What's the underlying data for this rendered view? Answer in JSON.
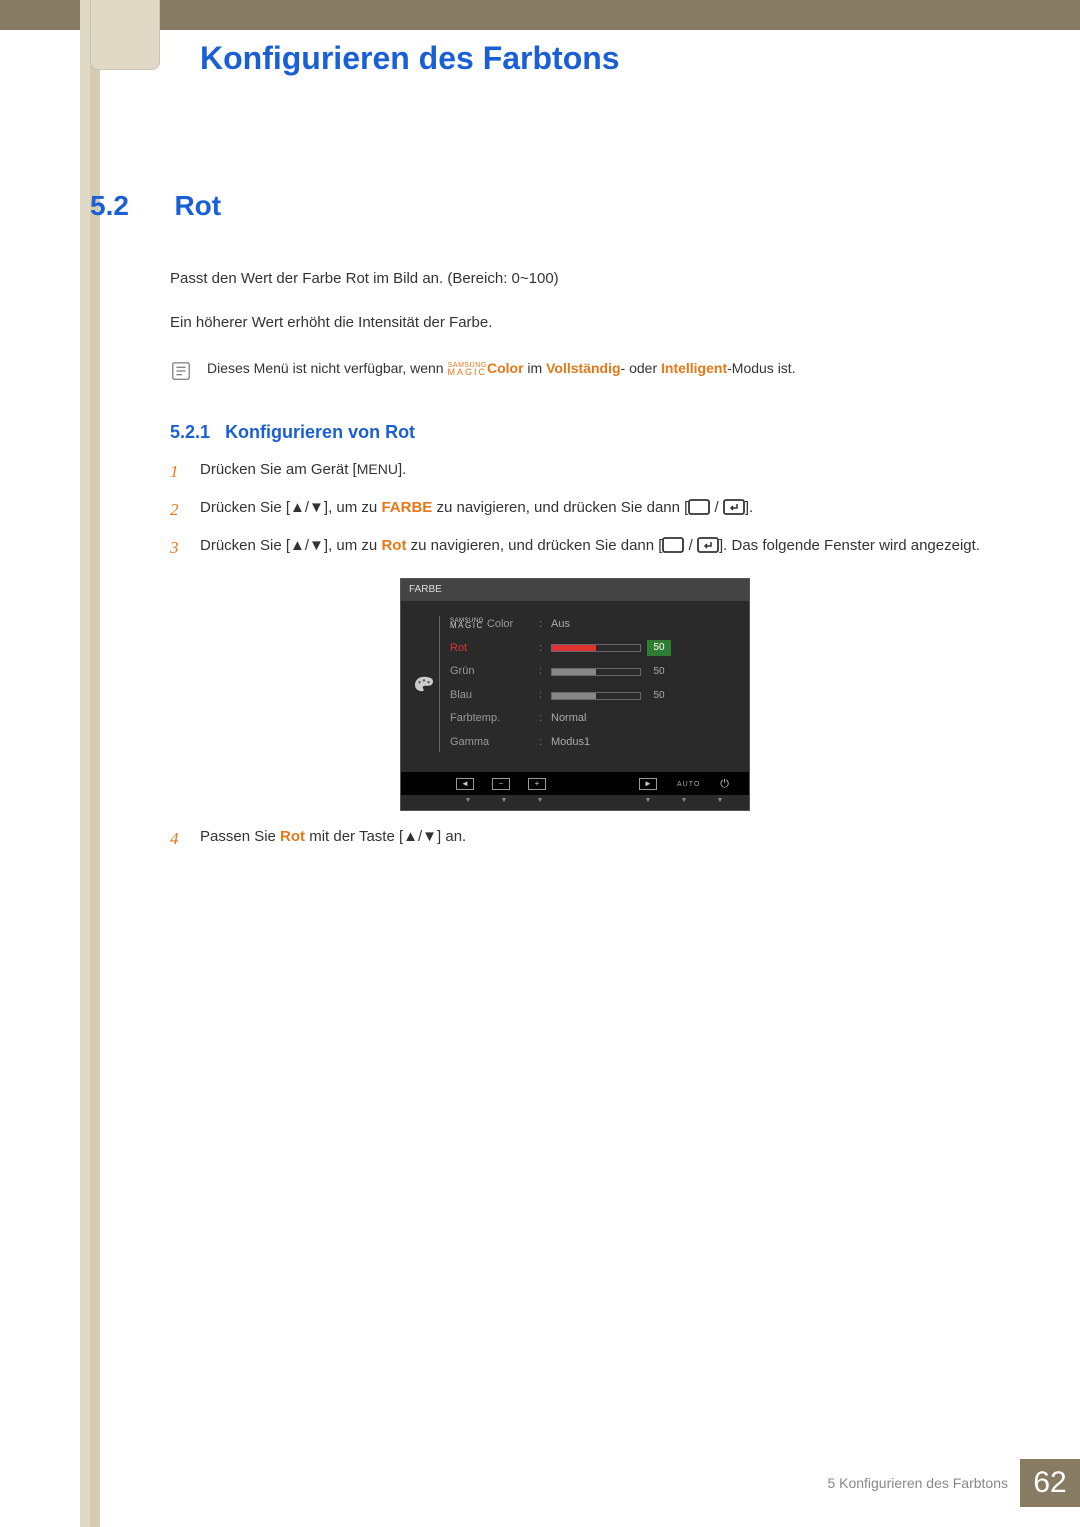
{
  "header": {
    "title": "Konfigurieren des Farbtons"
  },
  "section": {
    "number": "5.2",
    "title": "Rot",
    "paragraphs": {
      "p1": "Passt den Wert der Farbe Rot im Bild an. (Bereich: 0~100)",
      "p2": "Ein höherer Wert erhöht die Intensität der Farbe."
    },
    "note": {
      "pre": "Dieses Menü ist nicht verfügbar, wenn ",
      "magic_top": "SAMSUNG",
      "magic_bot": "MAGIC",
      "color_word": "Color",
      "mid": " im ",
      "mode1": "Vollständig",
      "mid2": "- oder ",
      "mode2": "Intelligent",
      "post": "-Modus ist."
    }
  },
  "subsection": {
    "number": "5.2.1",
    "title": "Konfigurieren von Rot"
  },
  "steps": {
    "s1": {
      "pre": "Drücken Sie am Gerät [",
      "btn": "MENU",
      "post": "]."
    },
    "s2": {
      "pre": "Drücken Sie [",
      "arrows": "▲/▼",
      "mid1": "], um zu ",
      "target": "FARBE",
      "mid2": " zu navigieren, und drücken Sie dann [",
      "post": "]."
    },
    "s3": {
      "pre": "Drücken Sie [",
      "arrows": "▲/▼",
      "mid1": "], um zu ",
      "target": "Rot",
      "mid2": " zu navigieren, und drücken Sie dann [",
      "post": "]. Das folgende Fenster wird angezeigt."
    },
    "s4": {
      "pre": "Passen Sie ",
      "target": "Rot",
      "mid": " mit der Taste [",
      "arrows": "▲/▼",
      "post": "] an."
    }
  },
  "osd": {
    "title": "FARBE",
    "items": [
      {
        "label_magic": true,
        "label": "Color",
        "value_text": "Aus"
      },
      {
        "label": "Rot",
        "highlight": true,
        "bar": 50,
        "bar_color": "red",
        "num": "50",
        "num_hi": true
      },
      {
        "label": "Grün",
        "bar": 50,
        "bar_color": "grey",
        "num": "50"
      },
      {
        "label": "Blau",
        "bar": 50,
        "bar_color": "grey",
        "num": "50"
      },
      {
        "label": "Farbtemp.",
        "value_text": "Normal"
      },
      {
        "label": "Gamma",
        "value_text": "Modus1"
      }
    ],
    "footer": {
      "auto": "AUTO"
    }
  },
  "footer": {
    "chapter": "5 Konfigurieren des Farbtons",
    "page": "62"
  }
}
